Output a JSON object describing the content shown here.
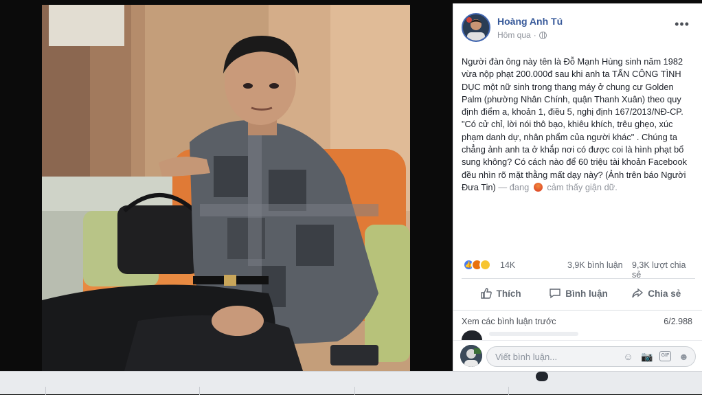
{
  "post": {
    "author": "Hoàng Anh Tú",
    "time": "Hôm qua",
    "body": "Người đàn ông này tên là Đỗ Mạnh Hùng sinh năm 1982 vừa nộp phạt 200.000đ sau khi anh ta TẤN CÔNG TÌNH DỤC một nữ sinh trong thang máy ở chung cư Golden Palm (phường Nhân Chính, quận Thanh Xuân) theo quy định điểm a, khoản 1, điều 5, nghị định 167/2013/NĐ-CP. \"Có cử chỉ, lời nói thô bạo, khiêu khích, trêu ghẹo, xúc phạm danh dự, nhân phẩm của người khác\" . Chúng ta chẳng ảnh anh ta ở khắp nơi có được coi là hình phạt bổ sung không? Có cách nào để 60 triệu tài khoản Facebook đều nhìn rõ mặt thằng mất dạy này? (Ảnh trên báo Người Đưa Tin)",
    "feeling_prefix": "— đang",
    "feeling": "cảm thấy giận dữ."
  },
  "stats": {
    "reactions": "14K",
    "comments": "3,9K bình luận",
    "shares": "9,3K lượt chia sẻ"
  },
  "actions": {
    "like": "Thích",
    "comment": "Bình luận",
    "share": "Chia sẻ"
  },
  "comments": {
    "view_previous": "Xem các bình luận trước",
    "count": "6/2.988"
  },
  "composer": {
    "placeholder": "Viết bình luận..."
  },
  "colors": {
    "author_link": "#365899",
    "like_blue": "#4a7cf0",
    "angry_orange": "#e9710f",
    "haha_yellow": "#f7c531"
  },
  "icons": [
    "globe-icon",
    "more-icon",
    "like-icon",
    "comment-icon",
    "share-icon",
    "emoji-icon",
    "camera-icon",
    "gif-icon",
    "sticker-icon"
  ]
}
